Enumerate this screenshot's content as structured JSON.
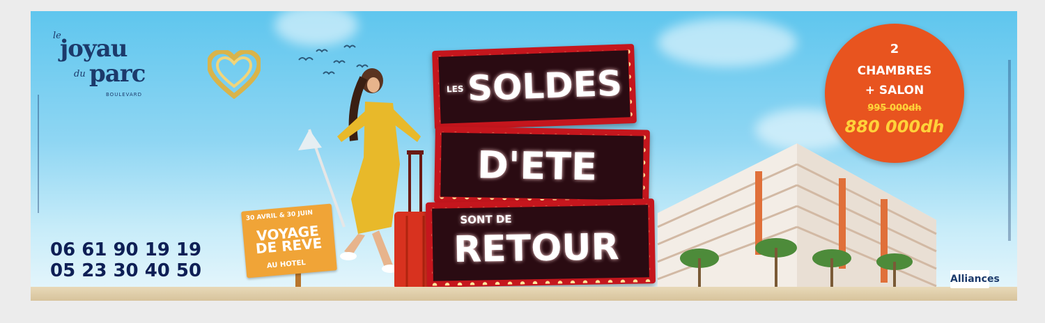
{
  "logo": {
    "article": "le",
    "word1": "joyau",
    "connector": "du",
    "word2": "parc",
    "tagline": "BOULEVARD"
  },
  "sign": {
    "prefix": "LES",
    "line1": "SOLDES",
    "line2": "D'ETE",
    "line3_small": "SONT DE",
    "line3": "RETOUR"
  },
  "phones": [
    "06 61 90 19 19",
    "05 23 30 40 50"
  ],
  "wood_sign": {
    "small": "30 AVRIL & 30 JUIN",
    "line1": "VOYAGE",
    "line2": "DE REVE",
    "line3": "AU HOTEL"
  },
  "promo": {
    "number": "2",
    "rooms": "CHAMBRES",
    "salon": "+ SALON",
    "old_price": "995 000dh",
    "new_price": "880 000dh"
  },
  "brand": "Alliances",
  "colors": {
    "sky": "#5fc6ee",
    "navy": "#0e1f55",
    "sign_red": "#c5161d",
    "promo_orange": "#e8541f",
    "price_yellow": "#ffd23a",
    "wood": "#f0a437"
  }
}
